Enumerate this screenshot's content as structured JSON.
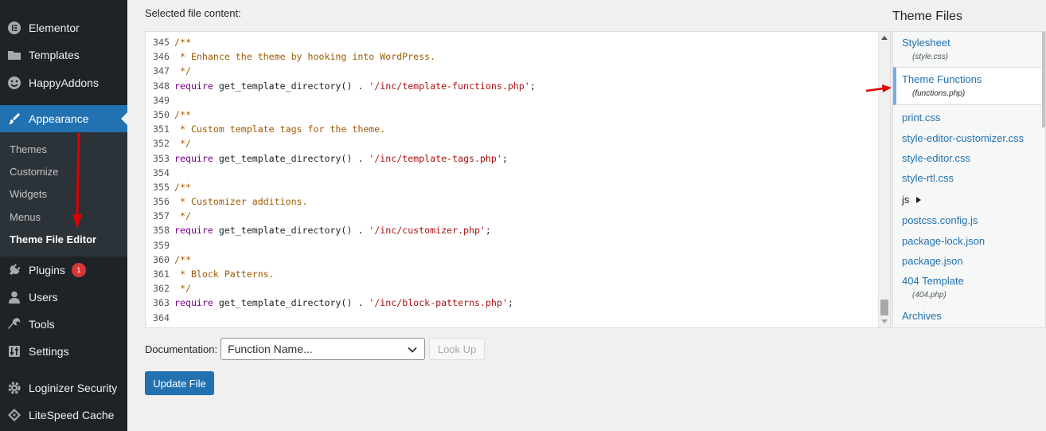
{
  "sidebar": {
    "items": [
      {
        "label": "Elementor",
        "icon": "elementor-icon"
      },
      {
        "label": "Templates",
        "icon": "folder-icon"
      },
      {
        "label": "HappyAddons",
        "icon": "happy-icon"
      },
      {
        "label": "Appearance",
        "icon": "paintbrush-icon"
      },
      {
        "label": "Plugins",
        "icon": "plugin-icon",
        "badge": "1"
      },
      {
        "label": "Users",
        "icon": "user-icon"
      },
      {
        "label": "Tools",
        "icon": "wrench-icon"
      },
      {
        "label": "Settings",
        "icon": "settings-icon"
      },
      {
        "label": "Loginizer Security",
        "icon": "gear-icon"
      },
      {
        "label": "LiteSpeed Cache",
        "icon": "diamond-icon"
      }
    ],
    "submenu": [
      "Themes",
      "Customize",
      "Widgets",
      "Menus",
      "Theme File Editor"
    ]
  },
  "editor": {
    "label": "Selected file content:",
    "lines": [
      {
        "n": "345",
        "text": "/**"
      },
      {
        "n": "346",
        "text": " * Enhance the theme by hooking into WordPress."
      },
      {
        "n": "347",
        "text": " */"
      },
      {
        "n": "348",
        "text": "require get_template_directory() . '/inc/template-functions.php';"
      },
      {
        "n": "349",
        "text": ""
      },
      {
        "n": "350",
        "text": "/**"
      },
      {
        "n": "351",
        "text": " * Custom template tags for the theme."
      },
      {
        "n": "352",
        "text": " */"
      },
      {
        "n": "353",
        "text": "require get_template_directory() . '/inc/template-tags.php';"
      },
      {
        "n": "354",
        "text": ""
      },
      {
        "n": "355",
        "text": "/**"
      },
      {
        "n": "356",
        "text": " * Customizer additions."
      },
      {
        "n": "357",
        "text": " */"
      },
      {
        "n": "358",
        "text": "require get_template_directory() . '/inc/customizer.php';"
      },
      {
        "n": "359",
        "text": ""
      },
      {
        "n": "360",
        "text": "/**"
      },
      {
        "n": "361",
        "text": " * Block Patterns."
      },
      {
        "n": "362",
        "text": " */"
      },
      {
        "n": "363",
        "text": "require get_template_directory() . '/inc/block-patterns.php';"
      },
      {
        "n": "364",
        "text": ""
      }
    ]
  },
  "documentation": {
    "label": "Documentation:",
    "select_value": "Function Name...",
    "lookup_label": "Look Up"
  },
  "update_label": "Update File",
  "theme_files": {
    "title": "Theme Files",
    "items": [
      {
        "label": "Stylesheet",
        "sub": "(style.css)"
      },
      {
        "label": "Theme Functions",
        "sub": "(functions.php)",
        "current": true
      },
      {
        "label": "print.css"
      },
      {
        "label": "style-editor-customizer.css"
      },
      {
        "label": "style-editor.css"
      },
      {
        "label": "style-rtl.css"
      },
      {
        "label": "js",
        "folder": true
      },
      {
        "label": "postcss.config.js"
      },
      {
        "label": "package-lock.json"
      },
      {
        "label": "package.json"
      },
      {
        "label": "404 Template",
        "sub": "(404.php)"
      },
      {
        "label": "Archives"
      }
    ]
  },
  "colors": {
    "sidebar_bg": "#1d2327",
    "accent": "#2271b1",
    "annotation_red": "#e00000"
  }
}
